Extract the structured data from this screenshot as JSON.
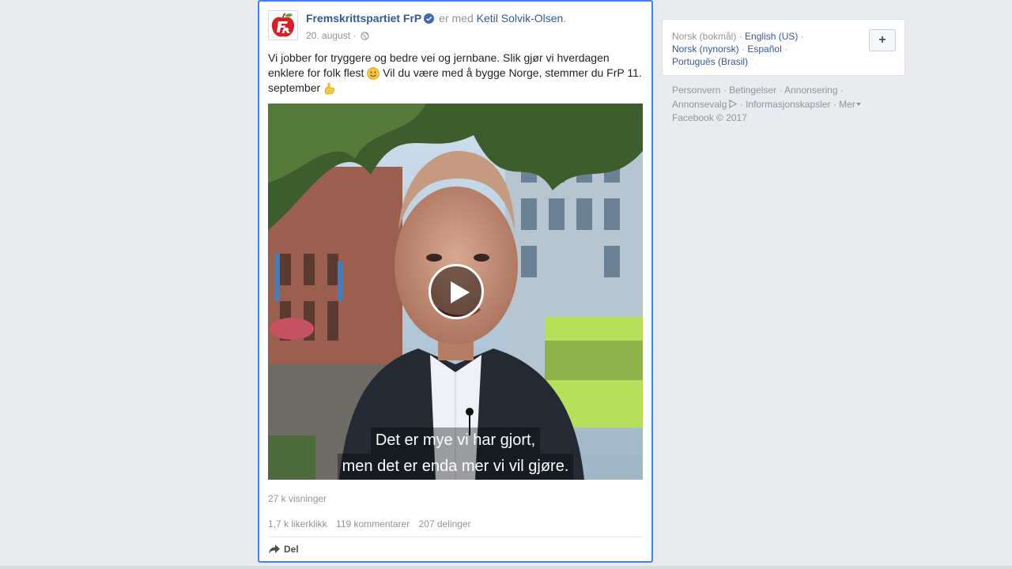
{
  "post": {
    "author": "Fremskrittspartiet FrP",
    "with_text": "er med",
    "tagged": "Ketil Solvik-Olsen",
    "tagged_suffix": ".",
    "date": "20. august",
    "date_sep": "·",
    "text_part1": "Vi jobber for tryggere og bedre vei og jernbane. Slik gjør vi hverdagen enklere for folk flest",
    "text_part2": "Vil du være med å bygge Norge, stemmer du FrP 11. september",
    "video": {
      "subtitle_line1": "Det er mye vi har gjort,",
      "subtitle_line2": "men det er enda mer vi vil gjøre."
    },
    "views": "27 k visninger",
    "likes": "1,7 k likerklikk",
    "comments": "119 kommentarer",
    "shares": "207 delinger",
    "share_label": "Del"
  },
  "languages": {
    "current": "Norsk (bokmål)",
    "sep": "·",
    "items": [
      "English (US)",
      "Norsk (nynorsk)",
      "Español",
      "Português (Brasil)"
    ],
    "add_label": "+"
  },
  "footer": {
    "links": [
      "Personvern",
      "Betingelser",
      "Annonsering",
      "Annonsevalg",
      "Informasjonskapsler",
      "Mer"
    ],
    "sep": "·",
    "copyright": "Facebook © 2017"
  },
  "colors": {
    "link": "#365899",
    "muted": "#90949c",
    "focus_border": "#4080ff",
    "background": "#e9ebee",
    "brand_red": "#d71f26"
  },
  "icons": {
    "verified": "verified-badge-icon",
    "audience": "globe-icon",
    "play": "play-icon",
    "share": "share-arrow-icon",
    "emoji1": "smiley-emoji-icon",
    "emoji2": "pointing-hand-emoji-icon"
  }
}
